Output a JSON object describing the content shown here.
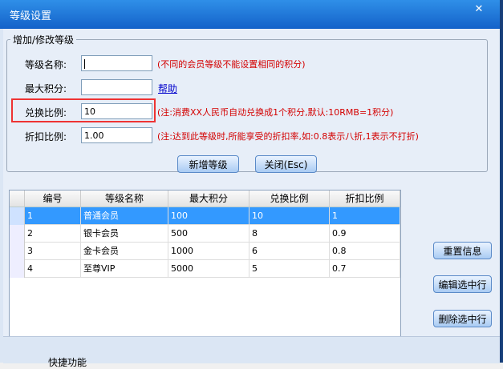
{
  "window": {
    "title": "等级设置",
    "close_glyph": "✕"
  },
  "group": {
    "title": "增加/修改等级"
  },
  "form": {
    "name_label": "等级名称:",
    "name_value": "",
    "name_note": "(不同的会员等级不能设置相同的积分)",
    "max_label": "最大积分:",
    "max_value": "",
    "help_link": "帮助",
    "ratio_label": "兑换比例:",
    "ratio_value": "10",
    "ratio_note": "(注:消费XX人民币自动兑换成1个积分,默认:10RMB=1积分)",
    "discount_label": "折扣比例:",
    "discount_value": "1.00",
    "discount_note": "(注:达到此等级时,所能享受的折扣率,如:0.8表示八折,1表示不打折)"
  },
  "buttons": {
    "add": "新增等级",
    "close": "关闭(Esc)",
    "reset": "重置信息",
    "edit": "编辑选中行",
    "delete": "删除选中行"
  },
  "table": {
    "headers": [
      "编号",
      "等级名称",
      "最大积分",
      "兑换比例",
      "折扣比例"
    ],
    "rows": [
      [
        "1",
        "普通会员",
        "100",
        "10",
        "1"
      ],
      [
        "2",
        "银卡会员",
        "500",
        "8",
        "0.9"
      ],
      [
        "3",
        "金卡会员",
        "1000",
        "6",
        "0.8"
      ],
      [
        "4",
        "至尊VIP",
        "5000",
        "5",
        "0.7"
      ]
    ]
  },
  "bottom": {
    "text": "快捷功能"
  }
}
